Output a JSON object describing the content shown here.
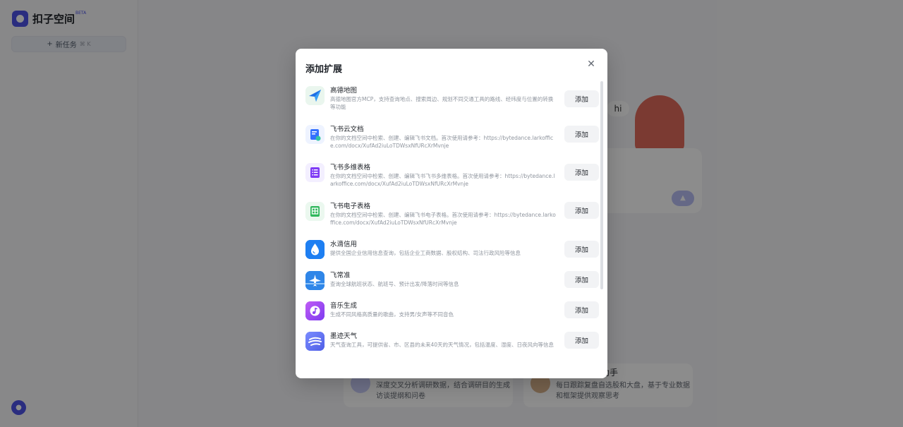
{
  "app": {
    "logo_text": "扣子空间",
    "logo_badge": "BETA",
    "new_task_label": "新任务",
    "new_task_shortcut": "⌘ K",
    "mascot_greeting": "hi"
  },
  "background_cards": [
    {
      "title": "",
      "desc": "深度交叉分析调研数据，结合调研目的生成访谈提纲和问卷"
    },
    {
      "title": "助手",
      "desc": "每日跟踪复盘自选股和大盘，基于专业数据和框架提供观察思考"
    }
  ],
  "modal": {
    "title": "添加扩展",
    "add_label": "添加",
    "items": [
      {
        "name": "高德地图",
        "desc": "高德地图官方MCP，支持查询地点、搜索周边、规划不同交通工具的路线、经纬度与位置的转换等功能",
        "icon": "amap-icon"
      },
      {
        "name": "飞书云文档",
        "desc": "在你的文档空间中检索、创建、编辑飞书文档。首次使用请参考：https://bytedance.larkoffice.com/docx/XufAd2iuLoTDWsxNfURcXrMvnje",
        "icon": "feishu-doc-icon"
      },
      {
        "name": "飞书多维表格",
        "desc": "在你的文档空间中检索、创建、编辑飞书飞书多维表格。首次使用请参考：https://bytedance.larkoffice.com/docx/XufAd2iuLoTDWsxNfURcXrMvnje",
        "icon": "feishu-bitable-icon"
      },
      {
        "name": "飞书电子表格",
        "desc": "在你的文档空间中检索、创建、编辑飞书电子表格。首次使用请参考：https://bytedance.larkoffice.com/docx/XufAd2iuLoTDWsxNfURcXrMvnje",
        "icon": "feishu-sheet-icon"
      },
      {
        "name": "水滴信用",
        "desc": "提供全国企业信用信息查询，包括企业工商数据、股权结构、司法行政风险等信息",
        "icon": "water-drop-icon"
      },
      {
        "name": "飞常准",
        "desc": "查询全球航班状态、航班号、预计出发/降落时间等信息",
        "icon": "plane-icon"
      },
      {
        "name": "音乐生成",
        "desc": "生成不同风格高质量的歌曲，支持男/女声等不同音色",
        "icon": "music-icon"
      },
      {
        "name": "墨迹天气",
        "desc": "天气查询工具，可提供省、市、区县的未来40天的天气情况，包括温度、湿度、日夜风向等信息",
        "icon": "weather-icon"
      }
    ]
  }
}
